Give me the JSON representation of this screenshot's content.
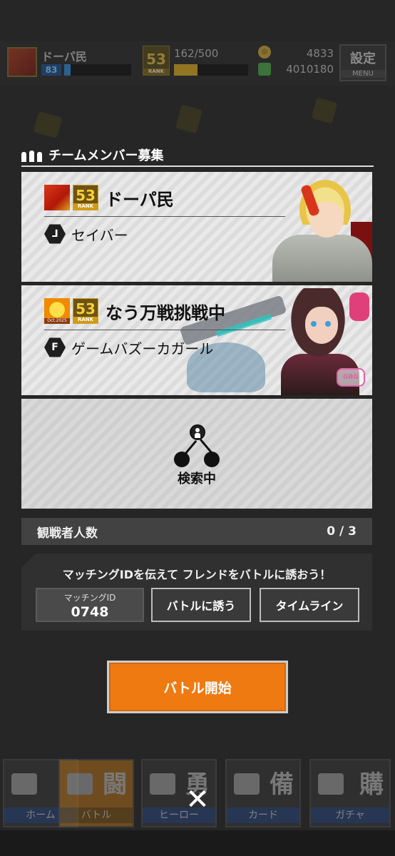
{
  "status_bar": {
    "player_name": "ドーパ民",
    "level": "83",
    "exp_fill": 0.1,
    "rank_number": "53",
    "rank_label": "RANK",
    "stamina": "162/500",
    "stamina_fill": 0.32,
    "coins": "4833",
    "gems": "4010180",
    "menu_kanji": "設定",
    "menu_label": "MENU"
  },
  "panel": {
    "title": "チームメンバー募集"
  },
  "members": [
    {
      "name": "ドーパ民",
      "rank_number": "53",
      "rank_label": "RANK",
      "role_icon": "saber-class-icon",
      "role_glyph": "⅃",
      "hero": "セイバー"
    },
    {
      "name": "なう万戦挑戦中",
      "rank_number": "53",
      "rank_label": "RANK",
      "avatar_caption": "Oct.2025",
      "role_icon": "gunner-class-icon",
      "role_glyph": "F",
      "hero": "ゲームバズーカガール"
    }
  ],
  "searching": {
    "label": "検索中"
  },
  "spectators": {
    "label": "観戦者人数",
    "count": "0 / 3"
  },
  "matching": {
    "invite_text": "マッチングIDを伝えて フレンドをバトルに誘おう！",
    "id_label": "マッチングID",
    "id_value": "0748",
    "invite_button": "バトルに誘う",
    "timeline_button": "タイムライン"
  },
  "battle_start": {
    "label": "バトル開始"
  },
  "bottom_nav": {
    "items": [
      {
        "label": "ホーム",
        "kanji": "",
        "icon": "home-icon"
      },
      {
        "label": "バトル",
        "kanji": "闘",
        "icon": "gamepad-icon"
      },
      {
        "label": "ヒーロー",
        "kanji": "勇",
        "icon": "hero-icon"
      },
      {
        "label": "カード",
        "kanji": "備",
        "icon": "card-icon"
      },
      {
        "label": "ガチャ",
        "kanji": "購",
        "icon": "gacha-icon"
      }
    ],
    "close_glyph": "✕"
  },
  "colors": {
    "accent_orange": "#ef7a12",
    "background": "#262626",
    "rank_gold": "#f6cf3a"
  }
}
